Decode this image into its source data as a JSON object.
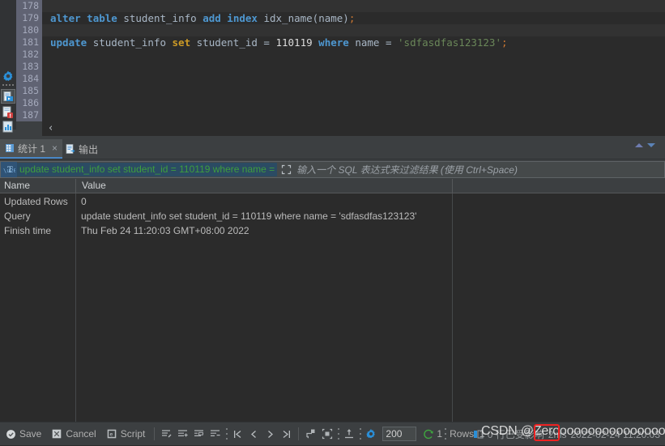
{
  "editor": {
    "gutter_lines": [
      "178",
      "179",
      "180",
      "181",
      "182",
      "183",
      "184",
      "185",
      "186",
      "187"
    ],
    "lines": [
      {
        "n": "178",
        "tokens": []
      },
      {
        "n": "179",
        "tokens": [
          {
            "t": "alter",
            "c": "kw"
          },
          {
            "t": " ",
            "c": "plain"
          },
          {
            "t": "table",
            "c": "kw"
          },
          {
            "t": " ",
            "c": "plain"
          },
          {
            "t": "student_info",
            "c": "ident"
          },
          {
            "t": " ",
            "c": "plain"
          },
          {
            "t": "add",
            "c": "kw"
          },
          {
            "t": " ",
            "c": "plain"
          },
          {
            "t": "index",
            "c": "kw"
          },
          {
            "t": " ",
            "c": "plain"
          },
          {
            "t": "idx_name(name)",
            "c": "ident"
          },
          {
            "t": ";",
            "c": "punct"
          }
        ]
      },
      {
        "n": "180",
        "tokens": []
      },
      {
        "n": "181",
        "tokens": [
          {
            "t": "update",
            "c": "kw"
          },
          {
            "t": " ",
            "c": "plain"
          },
          {
            "t": "student_info",
            "c": "ident"
          },
          {
            "t": " ",
            "c": "plain"
          },
          {
            "t": "set",
            "c": "kw2"
          },
          {
            "t": " ",
            "c": "plain"
          },
          {
            "t": "student_id",
            "c": "ident"
          },
          {
            "t": " = ",
            "c": "plain"
          },
          {
            "t": "110119",
            "c": "num"
          },
          {
            "t": " ",
            "c": "plain"
          },
          {
            "t": "where",
            "c": "kw"
          },
          {
            "t": " ",
            "c": "plain"
          },
          {
            "t": "name",
            "c": "ident"
          },
          {
            "t": " = ",
            "c": "plain"
          },
          {
            "t": "'sdfasdfas123123'",
            "c": "str"
          },
          {
            "t": ";",
            "c": "punct"
          }
        ]
      },
      {
        "n": "182",
        "tokens": []
      },
      {
        "n": "183",
        "tokens": []
      },
      {
        "n": "184",
        "tokens": []
      },
      {
        "n": "185",
        "tokens": []
      },
      {
        "n": "186",
        "tokens": []
      },
      {
        "n": "187",
        "tokens": []
      }
    ],
    "collapse_caret": "‹"
  },
  "rail_icons": [
    {
      "name": "settings-gear-icon"
    },
    {
      "name": "run-script-icon"
    },
    {
      "name": "stop-execution-icon"
    },
    {
      "name": "database-chart-icon"
    }
  ],
  "tabs": [
    {
      "label": "统计 1",
      "icon": "grid-icon",
      "close": "×",
      "active": true
    },
    {
      "label": "输出",
      "icon": "output-icon",
      "close": "",
      "active": false
    }
  ],
  "filter": {
    "type_icon": "T",
    "query_chip": "update student_info set student_id = 110119 where name =",
    "expand_icon": "expand-icon",
    "placeholder": "输入一个 SQL 表达式来过滤结果 (使用 Ctrl+Space)"
  },
  "table": {
    "columns": [
      "Name",
      "Value"
    ],
    "rows": [
      {
        "name": "Updated Rows",
        "value": "0"
      },
      {
        "name": "Query",
        "value": "update student_info set student_id = 110119 where name = 'sdfasdfas123123'"
      },
      {
        "name": "Finish time",
        "value": "Thu Feb 24 11:20:03 GMT+08:00 2022"
      }
    ]
  },
  "toolbar": {
    "save_label": "Save",
    "cancel_label": "Cancel",
    "script_label": "Script",
    "transpose_icon": "transpose-icon",
    "add_row_icon": "add-row-icon",
    "edit_value_icon": "edit-value-icon",
    "remove_row_icon": "remove-row-icon",
    "first_page_icon": "|◀",
    "prev_page_icon": "‹",
    "next_page_icon": "›",
    "last_page_icon": "▶|",
    "reload_icon": "reload-page-icon",
    "select_all_icon": "select-all-icon",
    "export_icon": "export-icon",
    "settings_icon": "settings-icon",
    "page_size_value": "200",
    "refresh_icon": "refresh-icon",
    "refresh_count": "1",
    "rows_label": "Rows: 1"
  },
  "status": {
    "db_icon": "database-icon",
    "affected": "0 行已受影响",
    "duration": "2ms",
    "timestamp": "2022-02-24 11:20:03"
  },
  "annotation": {
    "watermark": "CSDN @Zeroooooooooooooooooo",
    "highlight_target": "2ms"
  },
  "colors": {
    "accent": "#4a88c7",
    "keyword": "#4e97d0",
    "string": "#6a8759",
    "filter_green": "#3e9e3e",
    "highlight_red": "#ee2222",
    "panel_bg": "#3c3f41",
    "editor_bg": "#2b2b2b"
  }
}
